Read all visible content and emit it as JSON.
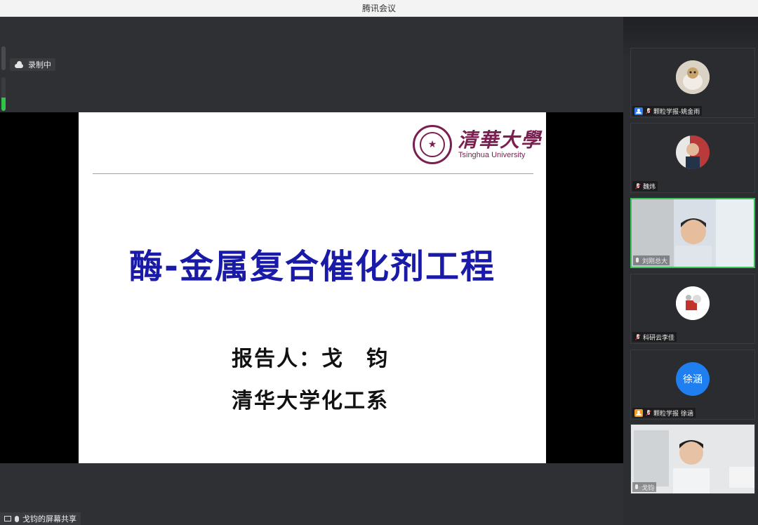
{
  "window": {
    "title": "腾讯会议"
  },
  "status": {
    "recording_label": "录制中",
    "mic_level": 0.4
  },
  "slide": {
    "university_cn": "清華大學",
    "university_en": "Tsinghua University",
    "title": "酶-金属复合催化剂工程",
    "reporter": "报告人：戈　钧",
    "department": "清华大学化工系"
  },
  "share_bar": {
    "label": "戈钧的屏幕共享"
  },
  "participants": [
    {
      "name": "颗粒学报-姚金雨",
      "badge": "host",
      "video": false
    },
    {
      "name": "魏炜",
      "badge": "",
      "video": true
    },
    {
      "name": "刘刚总大",
      "badge": "",
      "video": true,
      "active": true
    },
    {
      "name": "科研云李佳",
      "badge": "",
      "video": false
    },
    {
      "name": "颗粒学报 徐涵",
      "badge": "guest",
      "video": false,
      "avatar_text": "徐涵"
    },
    {
      "name": "戈钧",
      "badge": "",
      "video": true
    }
  ],
  "colors": {
    "accent_green": "#3cc45c",
    "title_blue": "#1a1aa8",
    "tsinghua_purple": "#7a1f4f"
  }
}
